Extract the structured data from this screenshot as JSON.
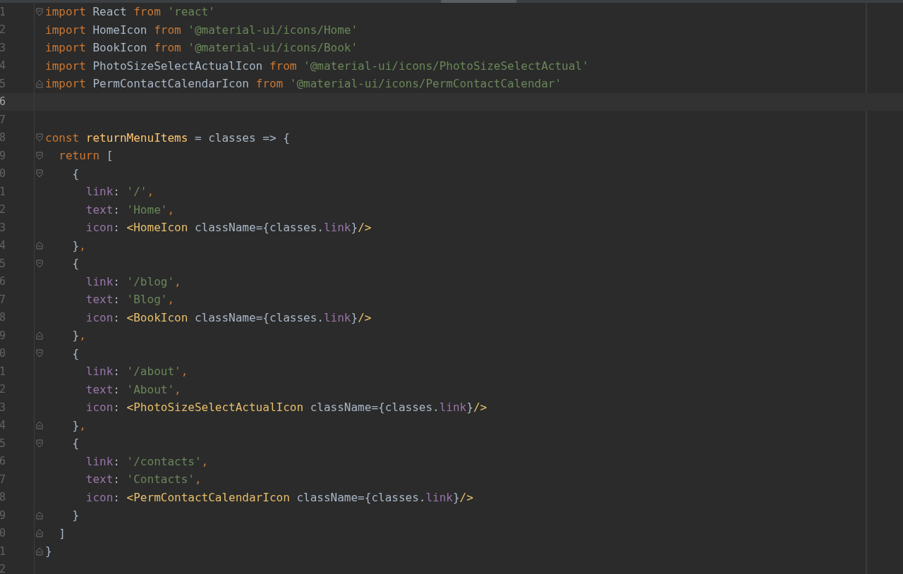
{
  "editor": {
    "lines": [
      {
        "number": "1",
        "current": false,
        "fold_marker": {
          "kind": "open"
        },
        "tokens": [
          {
            "text": "import",
            "kind": "keyword"
          },
          {
            "text": " React ",
            "kind": "plain"
          },
          {
            "text": "from",
            "kind": "keyword"
          },
          {
            "text": " 'react'",
            "kind": "string"
          }
        ]
      },
      {
        "number": "2",
        "current": false,
        "tokens": [
          {
            "text": "import",
            "kind": "keyword"
          },
          {
            "text": " HomeIcon ",
            "kind": "plain"
          },
          {
            "text": "from",
            "kind": "keyword"
          },
          {
            "text": " '@material-ui/icons/Home'",
            "kind": "string"
          }
        ]
      },
      {
        "number": "3",
        "current": false,
        "tokens": [
          {
            "text": "import",
            "kind": "keyword"
          },
          {
            "text": " BookIcon ",
            "kind": "plain"
          },
          {
            "text": "from",
            "kind": "keyword"
          },
          {
            "text": " '@material-ui/icons/Book'",
            "kind": "string"
          }
        ]
      },
      {
        "number": "4",
        "current": false,
        "tokens": [
          {
            "text": "import",
            "kind": "keyword"
          },
          {
            "text": " PhotoSizeSelectActualIcon ",
            "kind": "plain"
          },
          {
            "text": "from",
            "kind": "keyword"
          },
          {
            "text": " '@material-ui/icons/PhotoSizeSelectActual'",
            "kind": "string"
          }
        ]
      },
      {
        "number": "5",
        "current": false,
        "fold_marker": {
          "kind": "close"
        },
        "tokens": [
          {
            "text": "import",
            "kind": "keyword"
          },
          {
            "text": " PermContactCalendarIcon ",
            "kind": "plain"
          },
          {
            "text": "from",
            "kind": "keyword"
          },
          {
            "text": " '@material-ui/icons/PermContactCalendar'",
            "kind": "string"
          }
        ]
      },
      {
        "number": "6",
        "current": true
      },
      {
        "number": "7",
        "current": false
      },
      {
        "number": "8",
        "current": false,
        "fold_marker": {
          "kind": "open"
        },
        "tokens": [
          {
            "text": "const",
            "kind": "keyword"
          },
          {
            "text": " returnMenuItems",
            "kind": "function"
          },
          {
            "text": " = classes => {",
            "kind": "plain"
          }
        ]
      },
      {
        "number": "9",
        "current": false,
        "fold_marker": {
          "kind": "open"
        },
        "tokens": [
          {
            "text": "  return",
            "kind": "keyword"
          },
          {
            "text": " [",
            "kind": "plain"
          }
        ]
      },
      {
        "number": "0",
        "current": false,
        "fold_marker": {
          "kind": "open"
        },
        "tokens": [
          {
            "text": "    {",
            "kind": "plain"
          }
        ]
      },
      {
        "number": "1",
        "current": false,
        "tokens": [
          {
            "text": "      link",
            "kind": "property"
          },
          {
            "text": ": ",
            "kind": "plain"
          },
          {
            "text": "'/'",
            "kind": "string"
          },
          {
            "text": ",",
            "kind": "keyword"
          }
        ]
      },
      {
        "number": "2",
        "current": false,
        "tokens": [
          {
            "text": "      text",
            "kind": "property"
          },
          {
            "text": ": ",
            "kind": "plain"
          },
          {
            "text": "'Home'",
            "kind": "string"
          },
          {
            "text": ",",
            "kind": "keyword"
          }
        ]
      },
      {
        "number": "3",
        "current": false,
        "tokens": [
          {
            "text": "      icon",
            "kind": "property"
          },
          {
            "text": ": ",
            "kind": "plain"
          },
          {
            "text": "<HomeIcon",
            "kind": "tag"
          },
          {
            "text": " className={classes.",
            "kind": "plain"
          },
          {
            "text": "link",
            "kind": "property"
          },
          {
            "text": "}",
            "kind": "plain"
          },
          {
            "text": "/>",
            "kind": "tag"
          }
        ]
      },
      {
        "number": "4",
        "current": false,
        "fold_marker": {
          "kind": "close"
        },
        "tokens": [
          {
            "text": "    }",
            "kind": "plain"
          },
          {
            "text": ",",
            "kind": "keyword"
          }
        ]
      },
      {
        "number": "5",
        "current": false,
        "fold_marker": {
          "kind": "open"
        },
        "tokens": [
          {
            "text": "    {",
            "kind": "plain"
          }
        ]
      },
      {
        "number": "6",
        "current": false,
        "tokens": [
          {
            "text": "      link",
            "kind": "property"
          },
          {
            "text": ": ",
            "kind": "plain"
          },
          {
            "text": "'/blog'",
            "kind": "string"
          },
          {
            "text": ",",
            "kind": "keyword"
          }
        ]
      },
      {
        "number": "7",
        "current": false,
        "tokens": [
          {
            "text": "      text",
            "kind": "property"
          },
          {
            "text": ": ",
            "kind": "plain"
          },
          {
            "text": "'Blog'",
            "kind": "string"
          },
          {
            "text": ",",
            "kind": "keyword"
          }
        ]
      },
      {
        "number": "8",
        "current": false,
        "tokens": [
          {
            "text": "      icon",
            "kind": "property"
          },
          {
            "text": ": ",
            "kind": "plain"
          },
          {
            "text": "<BookIcon",
            "kind": "tag"
          },
          {
            "text": " className={classes.",
            "kind": "plain"
          },
          {
            "text": "link",
            "kind": "property"
          },
          {
            "text": "}",
            "kind": "plain"
          },
          {
            "text": "/>",
            "kind": "tag"
          }
        ]
      },
      {
        "number": "9",
        "current": false,
        "fold_marker": {
          "kind": "close"
        },
        "tokens": [
          {
            "text": "    }",
            "kind": "plain"
          },
          {
            "text": ",",
            "kind": "keyword"
          }
        ]
      },
      {
        "number": "0",
        "current": false,
        "fold_marker": {
          "kind": "open"
        },
        "tokens": [
          {
            "text": "    {",
            "kind": "plain"
          }
        ]
      },
      {
        "number": "1",
        "current": false,
        "tokens": [
          {
            "text": "      link",
            "kind": "property"
          },
          {
            "text": ": ",
            "kind": "plain"
          },
          {
            "text": "'/about'",
            "kind": "string"
          },
          {
            "text": ",",
            "kind": "keyword"
          }
        ]
      },
      {
        "number": "2",
        "current": false,
        "tokens": [
          {
            "text": "      text",
            "kind": "property"
          },
          {
            "text": ": ",
            "kind": "plain"
          },
          {
            "text": "'About'",
            "kind": "string"
          },
          {
            "text": ",",
            "kind": "keyword"
          }
        ]
      },
      {
        "number": "3",
        "current": false,
        "tokens": [
          {
            "text": "      icon",
            "kind": "property"
          },
          {
            "text": ": ",
            "kind": "plain"
          },
          {
            "text": "<PhotoSizeSelectActualIcon",
            "kind": "tag"
          },
          {
            "text": " className={classes.",
            "kind": "plain"
          },
          {
            "text": "link",
            "kind": "property"
          },
          {
            "text": "}",
            "kind": "plain"
          },
          {
            "text": "/>",
            "kind": "tag"
          }
        ]
      },
      {
        "number": "4",
        "current": false,
        "fold_marker": {
          "kind": "close"
        },
        "tokens": [
          {
            "text": "    }",
            "kind": "plain"
          },
          {
            "text": ",",
            "kind": "keyword"
          }
        ]
      },
      {
        "number": "5",
        "current": false,
        "fold_marker": {
          "kind": "open"
        },
        "tokens": [
          {
            "text": "    {",
            "kind": "plain"
          }
        ]
      },
      {
        "number": "6",
        "current": false,
        "tokens": [
          {
            "text": "      link",
            "kind": "property"
          },
          {
            "text": ": ",
            "kind": "plain"
          },
          {
            "text": "'/contacts'",
            "kind": "string"
          },
          {
            "text": ",",
            "kind": "keyword"
          }
        ]
      },
      {
        "number": "7",
        "current": false,
        "tokens": [
          {
            "text": "      text",
            "kind": "property"
          },
          {
            "text": ": ",
            "kind": "plain"
          },
          {
            "text": "'Contacts'",
            "kind": "string"
          },
          {
            "text": ",",
            "kind": "keyword"
          }
        ]
      },
      {
        "number": "8",
        "current": false,
        "tokens": [
          {
            "text": "      icon",
            "kind": "property"
          },
          {
            "text": ": ",
            "kind": "plain"
          },
          {
            "text": "<PermContactCalendarIcon",
            "kind": "tag"
          },
          {
            "text": " className={classes.",
            "kind": "plain"
          },
          {
            "text": "link",
            "kind": "property"
          },
          {
            "text": "}",
            "kind": "plain"
          },
          {
            "text": "/>",
            "kind": "tag"
          }
        ]
      },
      {
        "number": "9",
        "current": false,
        "fold_marker": {
          "kind": "close"
        },
        "tokens": [
          {
            "text": "    }",
            "kind": "plain"
          }
        ]
      },
      {
        "number": "0",
        "current": false,
        "fold_marker": {
          "kind": "close"
        },
        "tokens": [
          {
            "text": "  ]",
            "kind": "plain"
          }
        ]
      },
      {
        "number": "1",
        "current": false,
        "fold_marker": {
          "kind": "close"
        },
        "tokens": [
          {
            "text": "}",
            "kind": "plain"
          }
        ]
      },
      {
        "number": "2",
        "current": false
      }
    ]
  }
}
